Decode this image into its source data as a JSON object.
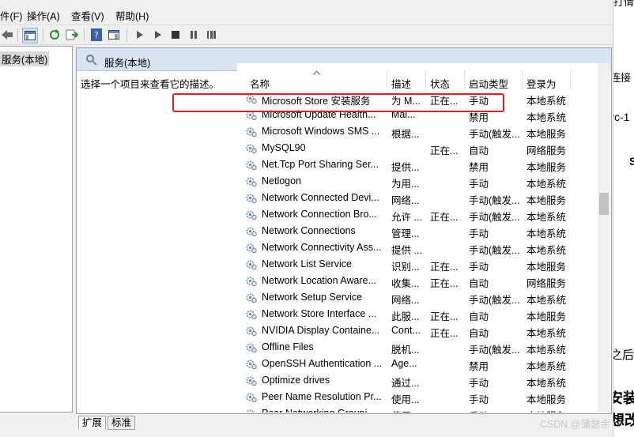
{
  "menubar": [
    "件(F)",
    "操作(A)",
    "查看(V)",
    "帮助(H)"
  ],
  "toolbar_icons": [
    "back-arrow-icon",
    "view-pane-icon",
    "refresh-icon",
    "export-icon",
    "help-icon",
    "properties-icon",
    "play-icon",
    "play-alt-icon",
    "stop-icon",
    "pause-icon",
    "restart-icon"
  ],
  "tree": {
    "root": "服务(本地)"
  },
  "pane": {
    "title": "服务(本地)",
    "description": "选择一个项目来查看它的描述。"
  },
  "columns": [
    "名称",
    "描述",
    "状态",
    "启动类型",
    "登录为"
  ],
  "services": [
    {
      "name": "Microsoft Store 安装服务",
      "desc": "为 M...",
      "status": "正在...",
      "startup": "手动",
      "logon": "本地系统"
    },
    {
      "name": "Microsoft Update Health...",
      "desc": "Mai...",
      "status": "",
      "startup": "禁用",
      "logon": "本地系统"
    },
    {
      "name": "Microsoft Windows SMS ...",
      "desc": "根据...",
      "status": "",
      "startup": "手动(触发...",
      "logon": "本地服务"
    },
    {
      "name": "MySQL90",
      "desc": "",
      "status": "正在...",
      "startup": "自动",
      "logon": "网络服务"
    },
    {
      "name": "Net.Tcp Port Sharing Ser...",
      "desc": "提供...",
      "status": "",
      "startup": "禁用",
      "logon": "本地服务"
    },
    {
      "name": "Netlogon",
      "desc": "为用...",
      "status": "",
      "startup": "手动",
      "logon": "本地系统"
    },
    {
      "name": "Network Connected Devi...",
      "desc": "网络...",
      "status": "",
      "startup": "手动(触发...",
      "logon": "本地服务"
    },
    {
      "name": "Network Connection Bro...",
      "desc": "允许 ...",
      "status": "正在...",
      "startup": "手动(触发...",
      "logon": "本地系统"
    },
    {
      "name": "Network Connections",
      "desc": "管理...",
      "status": "",
      "startup": "手动",
      "logon": "本地系统"
    },
    {
      "name": "Network Connectivity Ass...",
      "desc": "提供 ...",
      "status": "",
      "startup": "手动(触发...",
      "logon": "本地系统"
    },
    {
      "name": "Network List Service",
      "desc": "识别...",
      "status": "正在...",
      "startup": "手动",
      "logon": "本地服务"
    },
    {
      "name": "Network Location Aware...",
      "desc": "收集...",
      "status": "正在...",
      "startup": "自动",
      "logon": "网络服务"
    },
    {
      "name": "Network Setup Service",
      "desc": "网络...",
      "status": "",
      "startup": "手动(触发...",
      "logon": "本地系统"
    },
    {
      "name": "Network Store Interface ...",
      "desc": "此服...",
      "status": "正在...",
      "startup": "自动",
      "logon": "本地服务"
    },
    {
      "name": "NVIDIA Display Containe...",
      "desc": "Cont...",
      "status": "正在...",
      "startup": "自动",
      "logon": "本地系统"
    },
    {
      "name": "Offline Files",
      "desc": "脱机...",
      "status": "",
      "startup": "手动(触发...",
      "logon": "本地系统"
    },
    {
      "name": "OpenSSH Authentication ...",
      "desc": "Age...",
      "status": "",
      "startup": "禁用",
      "logon": "本地系统"
    },
    {
      "name": "Optimize drives",
      "desc": "通过...",
      "status": "",
      "startup": "手动",
      "logon": "本地系统"
    },
    {
      "name": "Peer Name Resolution Pr...",
      "desc": "使用...",
      "status": "",
      "startup": "手动",
      "logon": "本地服务"
    },
    {
      "name": "Peer Networking Groupi...",
      "desc": "使用...",
      "status": "",
      "startup": "手动",
      "logon": "本地服务"
    }
  ],
  "bottom_tabs": [
    "扩展",
    "标准"
  ],
  "right_panel": [
    "打情",
    "连接",
    "vc-1",
    "S",
    "之后",
    "安装",
    "想改"
  ],
  "watermark": "CSDN @蒲瑟余"
}
